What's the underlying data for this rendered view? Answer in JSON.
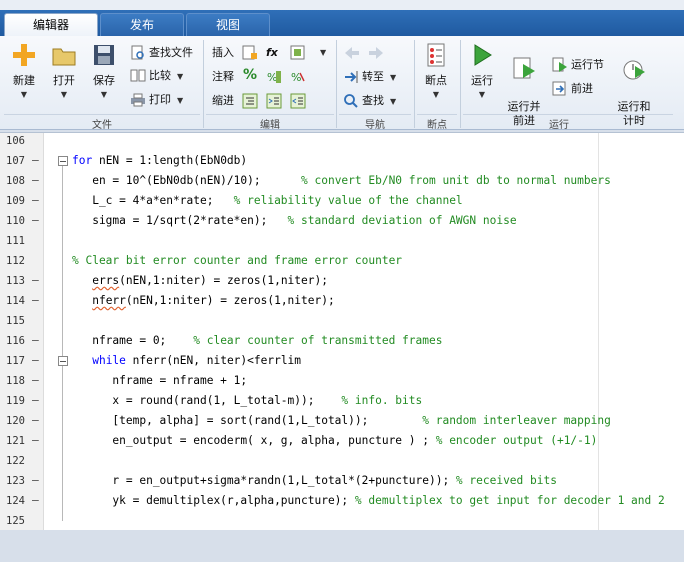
{
  "tabs": [
    {
      "label": "编辑器",
      "active": true
    },
    {
      "label": "发布",
      "active": false
    },
    {
      "label": "视图",
      "active": false
    }
  ],
  "ribbon": {
    "file": {
      "group_label": "文件",
      "new_label": "新建",
      "open_label": "打开",
      "save_label": "保存",
      "find_files_label": "查找文件",
      "compare_label": "比较",
      "print_label": "打印"
    },
    "edit": {
      "group_label": "编辑",
      "insert_label": "插入",
      "comment_label": "注释",
      "indent_label": "缩进",
      "fx_label": "fx"
    },
    "navigate": {
      "group_label": "导航",
      "goto_label": "转至",
      "find_label": "查找"
    },
    "breakpoints": {
      "group_label": "断点",
      "breakpoints_label": "断点"
    },
    "run": {
      "group_label": "运行",
      "run_label": "运行",
      "run_advance_label": "运行并\n前进",
      "run_section_label": "运行节",
      "advance_label": "前进",
      "run_time_label": "运行和\n计时"
    }
  },
  "editor": {
    "lines": [
      {
        "n": "106",
        "dash": "",
        "code": ""
      },
      {
        "n": "107",
        "dash": "–",
        "fold": true,
        "code": "for nEN = 1:length(EbN0db)"
      },
      {
        "n": "108",
        "dash": "–",
        "code": "   en = 10^(EbN0db(nEN)/10);      % convert Eb/N0 from unit db to normal numbers"
      },
      {
        "n": "109",
        "dash": "–",
        "code": "   L_c = 4*a*en*rate;   % reliability value of the channel"
      },
      {
        "n": "110",
        "dash": "–",
        "code": "   sigma = 1/sqrt(2*rate*en);   % standard deviation of AWGN noise"
      },
      {
        "n": "111",
        "dash": "",
        "code": ""
      },
      {
        "n": "112",
        "dash": "",
        "code": "% Clear bit error counter and frame error counter"
      },
      {
        "n": "113",
        "dash": "–",
        "code": "   errs(nEN,1:niter) = zeros(1,niter);"
      },
      {
        "n": "114",
        "dash": "–",
        "code": "   nferr(nEN,1:niter) = zeros(1,niter);"
      },
      {
        "n": "115",
        "dash": "",
        "code": ""
      },
      {
        "n": "116",
        "dash": "–",
        "code": "   nframe = 0;    % clear counter of transmitted frames"
      },
      {
        "n": "117",
        "dash": "–",
        "fold": true,
        "code": "   while nferr(nEN, niter)<ferrlim"
      },
      {
        "n": "118",
        "dash": "–",
        "code": "      nframe = nframe + 1;"
      },
      {
        "n": "119",
        "dash": "–",
        "code": "      x = round(rand(1, L_total-m));    % info. bits"
      },
      {
        "n": "120",
        "dash": "–",
        "code": "      [temp, alpha] = sort(rand(1,L_total));        % random interleaver mapping"
      },
      {
        "n": "121",
        "dash": "–",
        "code": "      en_output = encoderm( x, g, alpha, puncture ) ; % encoder output (+1/-1)"
      },
      {
        "n": "122",
        "dash": "",
        "code": ""
      },
      {
        "n": "123",
        "dash": "–",
        "code": "      r = en_output+sigma*randn(1,L_total*(2+puncture)); % received bits"
      },
      {
        "n": "124",
        "dash": "–",
        "code": "      yk = demultiplex(r,alpha,puncture); % demultiplex to get input for decoder 1 and 2"
      },
      {
        "n": "125",
        "dash": "",
        "code": ""
      }
    ]
  },
  "colors": {
    "keyword": "#0000ff",
    "comment": "#228b22",
    "tab_bar": "#1f5aa0"
  }
}
